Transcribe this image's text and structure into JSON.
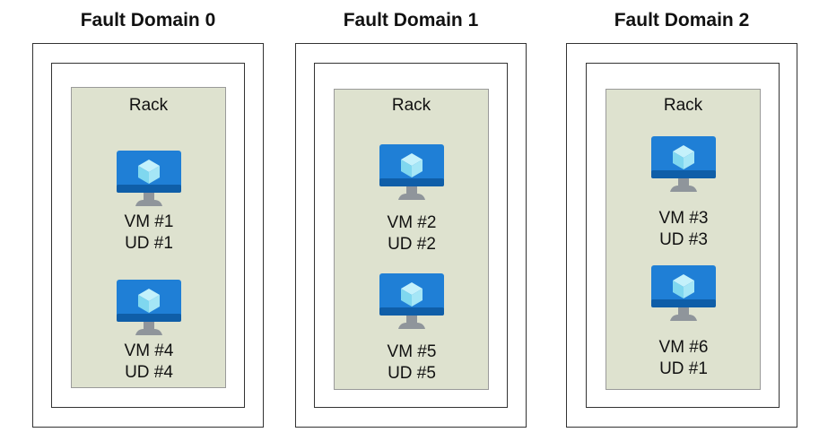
{
  "domains": [
    {
      "title": "Fault Domain 0",
      "rack_label": "Rack",
      "vms": [
        {
          "vm": "VM #1",
          "ud": "UD #1"
        },
        {
          "vm": "VM #4",
          "ud": "UD #4"
        }
      ]
    },
    {
      "title": "Fault Domain 1",
      "rack_label": "Rack",
      "vms": [
        {
          "vm": "VM #2",
          "ud": "UD #2"
        },
        {
          "vm": "VM #5",
          "ud": "UD #5"
        }
      ]
    },
    {
      "title": "Fault Domain 2",
      "rack_label": "Rack",
      "vms": [
        {
          "vm": "VM #3",
          "ud": "UD #3"
        },
        {
          "vm": "VM #6",
          "ud": "UD #1"
        }
      ]
    }
  ],
  "icons": {
    "vm": "virtual-machine-icon"
  },
  "colors": {
    "rack_fill": "#dee2cf",
    "monitor_blue": "#1f7fd6",
    "monitor_dark": "#0f5ea8",
    "cube_light": "#c4f1fb",
    "cube_mid": "#7fd7ef",
    "stand_gray": "#8f959b"
  }
}
